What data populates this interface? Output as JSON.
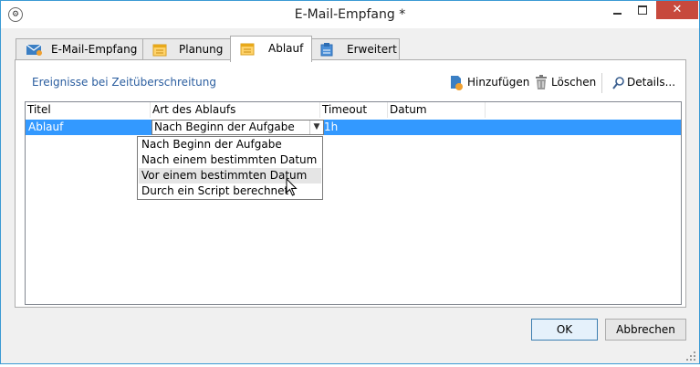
{
  "window": {
    "title": "E-Mail-Empfang *"
  },
  "tabs": [
    {
      "label": "E-Mail-Empfang",
      "icon": "envelope-icon"
    },
    {
      "label": "Planung",
      "icon": "calendar-icon"
    },
    {
      "label": "Ablauf",
      "icon": "calendar-icon",
      "active": true
    },
    {
      "label": "Erweitert",
      "icon": "clipboard-icon"
    }
  ],
  "panel": {
    "section_title": "Ereignisse bei Zeitüberschreitung",
    "toolbar": {
      "add_label": "Hinzufügen",
      "delete_label": "Löschen",
      "details_label": "Details..."
    }
  },
  "grid": {
    "columns": [
      "Titel",
      "Art des Ablaufs",
      "Timeout",
      "Datum"
    ],
    "rows": [
      {
        "title": "Ablauf",
        "type": "Nach Beginn der Aufgabe",
        "timeout": "1h",
        "date": ""
      }
    ]
  },
  "dropdown": {
    "options": [
      "Nach Beginn der Aufgabe",
      "Nach einem bestimmten Datum",
      "Vor einem bestimmten Datum",
      "Durch ein Script berechnet"
    ],
    "highlighted_index": 2
  },
  "buttons": {
    "ok_label": "OK",
    "cancel_label": "Abbrechen"
  },
  "colors": {
    "accent": "#3399ff",
    "title_blue": "#2a5d9f",
    "close_red": "#c7493d",
    "window_border": "#3b9ad4"
  }
}
